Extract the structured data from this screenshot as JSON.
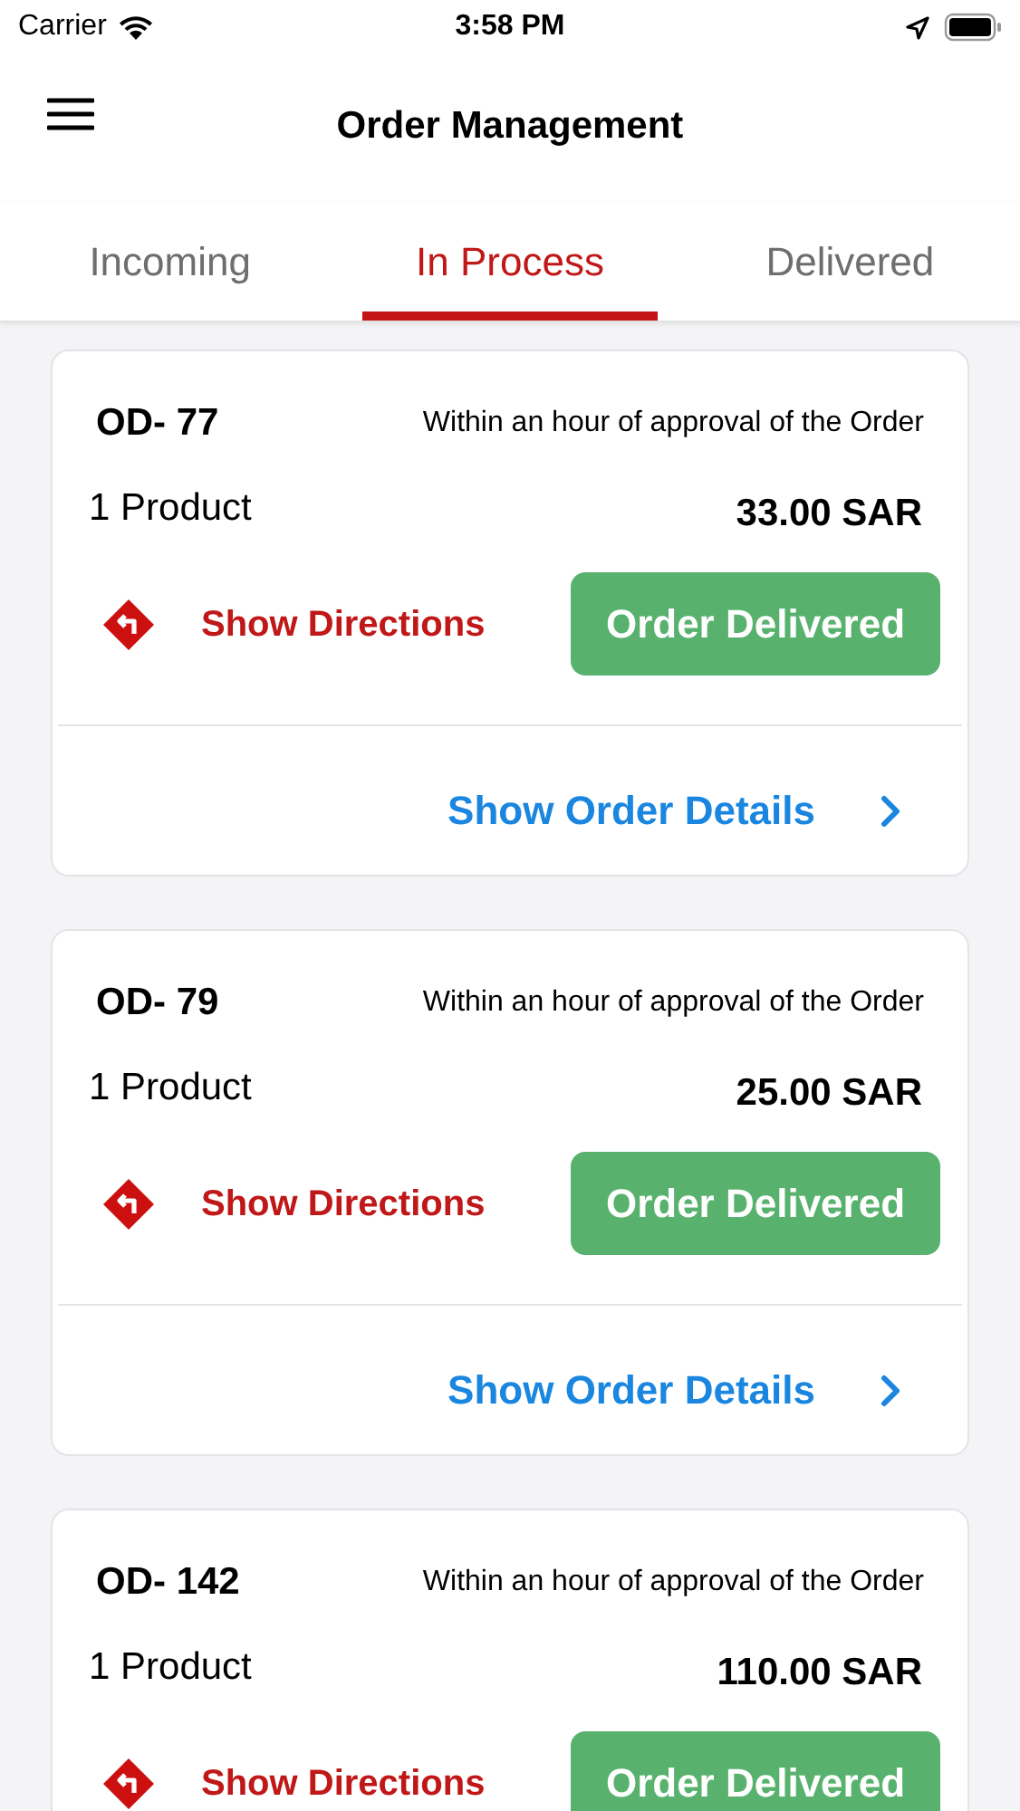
{
  "status_bar": {
    "carrier": "Carrier",
    "time": "3:58 PM"
  },
  "header": {
    "title": "Order Management"
  },
  "tabs": [
    {
      "label": "Incoming",
      "selected": false
    },
    {
      "label": "In Process",
      "selected": true
    },
    {
      "label": "Delivered",
      "selected": false
    }
  ],
  "orders": [
    {
      "id": "OD- 77",
      "delivery_time": "Within an hour of approval of the Order",
      "products": "1 Product",
      "total": "33.00 SAR",
      "directions": "Show Directions",
      "action": "Order Delivered",
      "details": "Show Order Details"
    },
    {
      "id": "OD- 79",
      "delivery_time": "Within an hour of approval of the Order",
      "products": "1 Product",
      "total": "25.00 SAR",
      "directions": "Show Directions",
      "action": "Order Delivered",
      "details": "Show Order Details"
    },
    {
      "id": "OD- 142",
      "delivery_time": "Within an hour of approval of the Order",
      "products": "1 Product",
      "total": "110.00 SAR",
      "directions": "Show Directions",
      "action": "Order Delivered"
    }
  ]
}
